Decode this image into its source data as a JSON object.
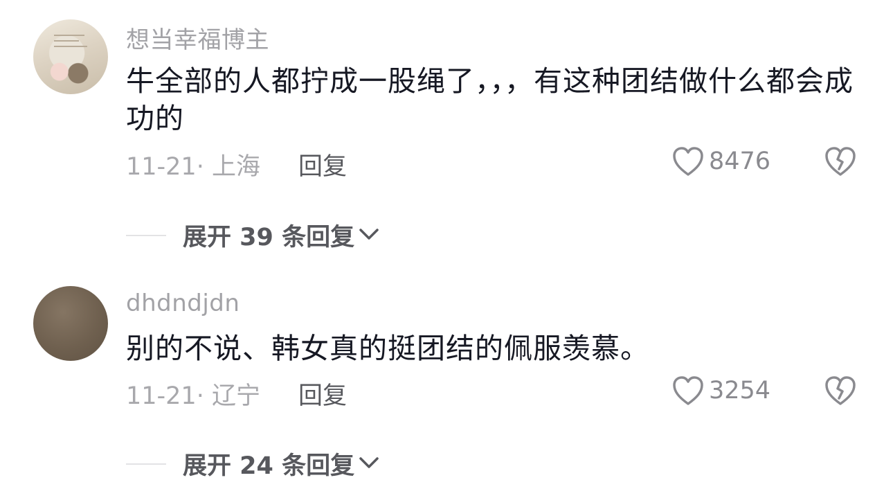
{
  "comments": [
    {
      "username": "想当幸福博主",
      "content": "牛全部的人都拧成一股绳了，，，有这种团结做什么都会成功的",
      "date_location": "11-21· 上海",
      "reply_label": "回复",
      "likes": "8476",
      "expand_label": "展开 39 条回复"
    },
    {
      "username": "dhdndjdn",
      "content": "别的不说、韩女真的挺团结的佩服羡慕。",
      "date_location": "11-21· 辽宁",
      "reply_label": "回复",
      "likes": "3254",
      "expand_label": "展开 24 条回复"
    }
  ],
  "icons": {
    "like": "heart-outline-icon",
    "dislike": "broken-heart-icon",
    "expand": "chevron-down-icon"
  },
  "colors": {
    "username": "#a2a2a6",
    "content": "#161823",
    "meta": "#a8a8ac",
    "action": "#57585d"
  }
}
